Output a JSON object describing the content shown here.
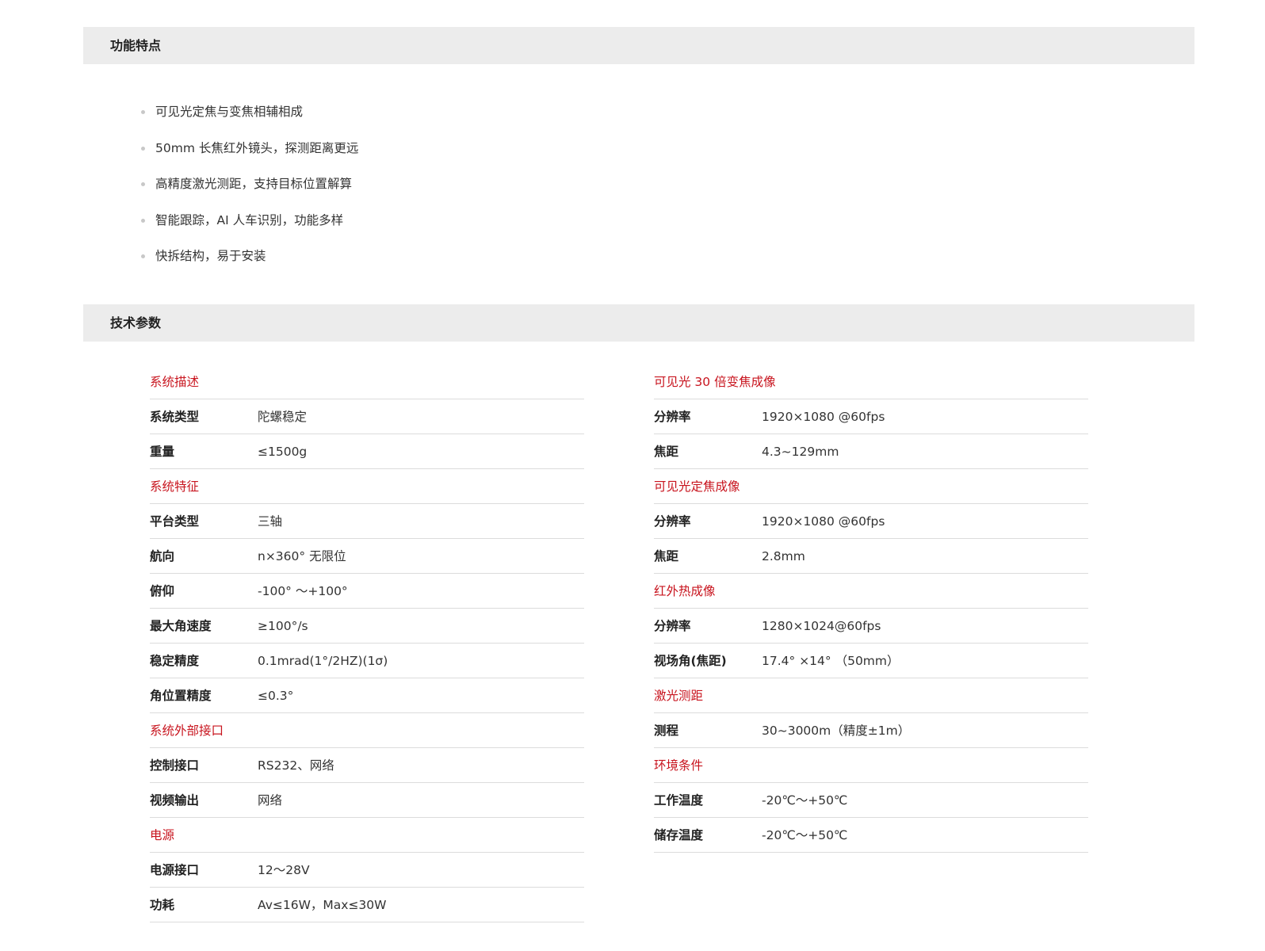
{
  "features": {
    "title": "功能特点",
    "items": [
      "可见光定焦与变焦相辅相成",
      "50mm 长焦红外镜头，探测距离更远",
      "高精度激光测距，支持目标位置解算",
      "智能跟踪，AI 人车识别，功能多样",
      "快拆结构，易于安装"
    ]
  },
  "specs": {
    "title": "技术参数",
    "left": [
      {
        "group": "系统描述",
        "rows": [
          {
            "label": "系统类型",
            "value": "陀螺稳定"
          },
          {
            "label": "重量",
            "value": "≤1500g"
          }
        ]
      },
      {
        "group": "系统特征",
        "rows": [
          {
            "label": "平台类型",
            "value": "三轴"
          },
          {
            "label": "航向",
            "value": "n×360° 无限位"
          },
          {
            "label": "俯仰",
            "value": "-100° ～+100°"
          },
          {
            "label": "最大角速度",
            "value": "≥100°/s"
          },
          {
            "label": "稳定精度",
            "value": "0.1mrad(1°/2HZ)(1σ)"
          },
          {
            "label": "角位置精度",
            "value": "≤0.3°"
          }
        ]
      },
      {
        "group": "系统外部接口",
        "rows": [
          {
            "label": "控制接口",
            "value": "RS232、网络"
          },
          {
            "label": "视频输出",
            "value": "网络"
          }
        ]
      },
      {
        "group": "电源",
        "rows": [
          {
            "label": "电源接口",
            "value": "12～28V"
          },
          {
            "label": "功耗",
            "value": "Av≤16W，Max≤30W"
          }
        ]
      }
    ],
    "right": [
      {
        "group": "可见光 30 倍变焦成像",
        "rows": [
          {
            "label": "分辨率",
            "value": "1920×1080 @60fps"
          },
          {
            "label": "焦距",
            "value": "4.3~129mm"
          }
        ]
      },
      {
        "group": "可见光定焦成像",
        "rows": [
          {
            "label": "分辨率",
            "value": "1920×1080 @60fps"
          },
          {
            "label": "焦距",
            "value": "2.8mm"
          }
        ]
      },
      {
        "group": "红外热成像",
        "rows": [
          {
            "label": "分辨率",
            "value": "1280×1024@60fps"
          },
          {
            "label": "视场角(焦距)",
            "value": "17.4° ×14° （50mm）"
          }
        ]
      },
      {
        "group": "激光测距",
        "rows": [
          {
            "label": "测程",
            "value": "30~3000m（精度±1m）"
          }
        ]
      },
      {
        "group": "环境条件",
        "rows": [
          {
            "label": "工作温度",
            "value": "-20℃～+50℃"
          },
          {
            "label": "储存温度",
            "value": "-20℃～+50℃"
          }
        ]
      }
    ]
  }
}
